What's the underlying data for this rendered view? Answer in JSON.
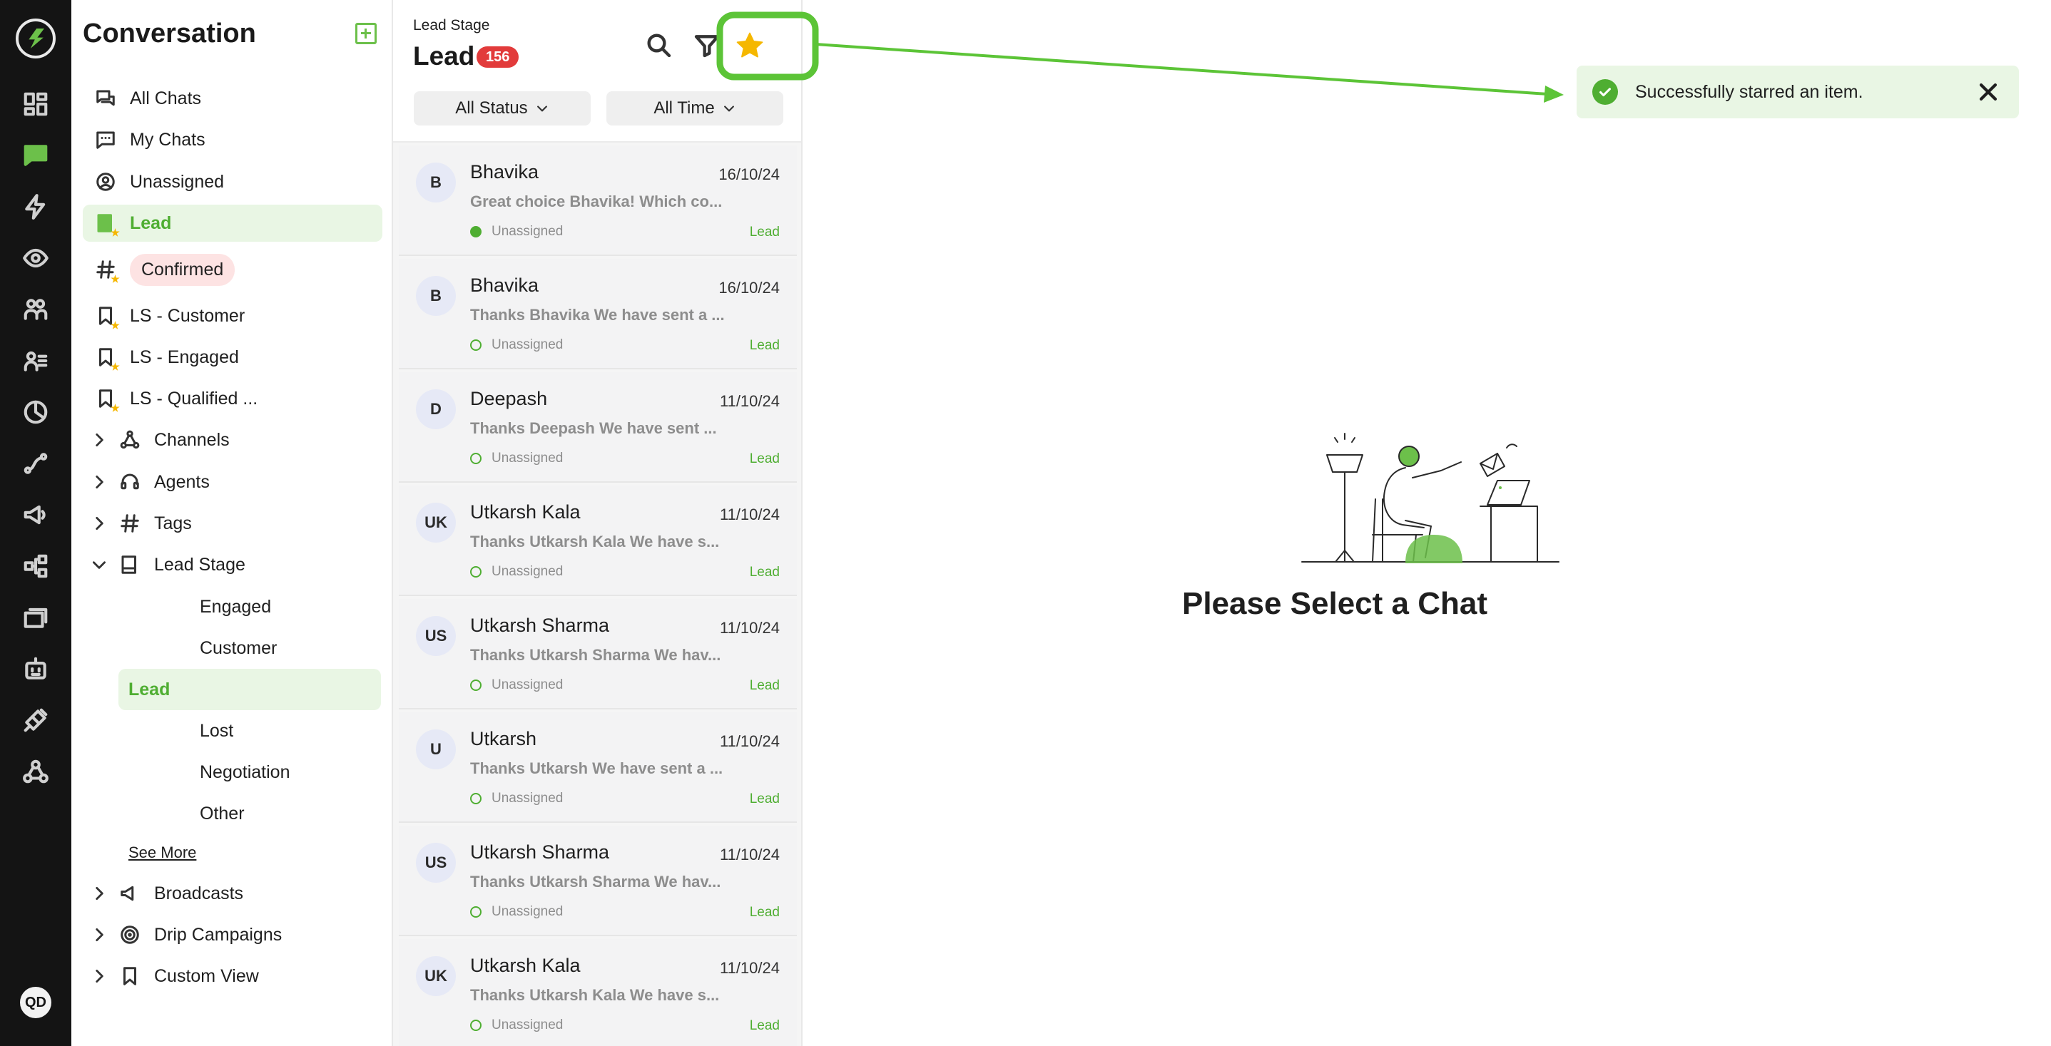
{
  "sidebar": {
    "title": "Conversation",
    "items": [
      {
        "label": "All Chats"
      },
      {
        "label": "My Chats"
      },
      {
        "label": "Unassigned"
      },
      {
        "label": "Lead"
      },
      {
        "label": "Confirmed"
      },
      {
        "label": "LS - Customer"
      },
      {
        "label": "LS - Engaged"
      },
      {
        "label": "LS - Qualified ..."
      }
    ],
    "groups": [
      {
        "label": "Channels"
      },
      {
        "label": "Agents"
      },
      {
        "label": "Tags"
      },
      {
        "label": "Lead Stage"
      },
      {
        "label": "Broadcasts"
      },
      {
        "label": "Drip Campaigns"
      },
      {
        "label": "Custom View"
      }
    ],
    "lead_stage_children": [
      {
        "label": "Engaged"
      },
      {
        "label": "Customer"
      },
      {
        "label": "Lead"
      },
      {
        "label": "Lost"
      },
      {
        "label": "Negotiation"
      },
      {
        "label": "Other"
      }
    ],
    "see_more": "See More"
  },
  "rail": {
    "avatar_initials": "QD",
    "icons": [
      "dashboard-icon",
      "chat-icon",
      "bolt-icon",
      "eye-icon",
      "team-icon",
      "contacts-list-icon",
      "analytics-icon",
      "route-icon",
      "megaphone-icon",
      "flow-icon",
      "windows-icon",
      "bot-icon",
      "plug-icon",
      "webhook-icon"
    ],
    "active_icon": "chat-icon"
  },
  "chatlist": {
    "kicker": "Lead Stage",
    "title": "Lead",
    "count": "156",
    "filter_status": "All Status",
    "filter_time": "All Time",
    "chats": [
      {
        "initials": "B",
        "name": "Bhavika",
        "date": "16/10/24",
        "message": "Great choice Bhavika! Which co...",
        "status": "Unassigned",
        "stage": "Lead"
      },
      {
        "initials": "B",
        "name": "Bhavika",
        "date": "16/10/24",
        "message": "Thanks Bhavika We have sent a ...",
        "status": "Unassigned",
        "stage": "Lead"
      },
      {
        "initials": "D",
        "name": "Deepash",
        "date": "11/10/24",
        "message": "Thanks Deepash We have sent ...",
        "status": "Unassigned",
        "stage": "Lead"
      },
      {
        "initials": "UK",
        "name": "Utkarsh Kala",
        "date": "11/10/24",
        "message": "Thanks Utkarsh Kala We have s...",
        "status": "Unassigned",
        "stage": "Lead"
      },
      {
        "initials": "US",
        "name": "Utkarsh Sharma",
        "date": "11/10/24",
        "message": "Thanks Utkarsh Sharma We hav...",
        "status": "Unassigned",
        "stage": "Lead"
      },
      {
        "initials": "U",
        "name": "Utkarsh",
        "date": "11/10/24",
        "message": "Thanks Utkarsh We have sent a ...",
        "status": "Unassigned",
        "stage": "Lead"
      },
      {
        "initials": "US",
        "name": "Utkarsh Sharma",
        "date": "11/10/24",
        "message": "Thanks Utkarsh Sharma We hav...",
        "status": "Unassigned",
        "stage": "Lead"
      },
      {
        "initials": "UK",
        "name": "Utkarsh Kala",
        "date": "11/10/24",
        "message": "Thanks Utkarsh Kala We have s...",
        "status": "Unassigned",
        "stage": "Lead"
      }
    ]
  },
  "main": {
    "toast_text": "Successfully starred an item.",
    "empty_title": "Please Select a Chat"
  },
  "colors": {
    "accent": "#6cc04a",
    "accent_text": "#4fae32",
    "rail_bg": "#141414",
    "count_badge": "#e23b3b",
    "star": "#f5b700",
    "toast_bg": "#e9f6e4"
  }
}
